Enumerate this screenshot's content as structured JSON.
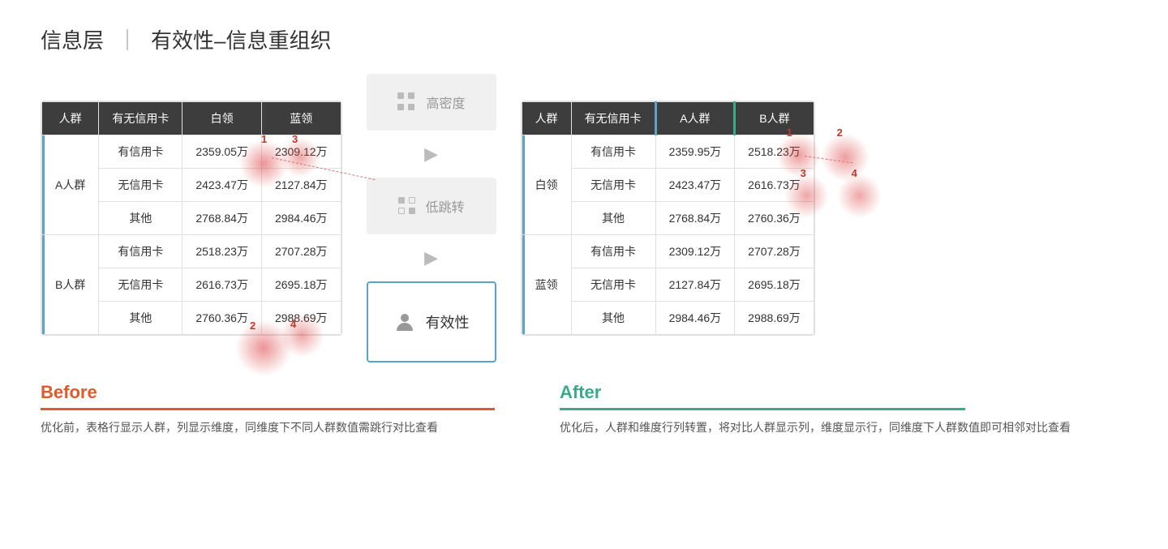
{
  "title": {
    "main": "信息层",
    "divider": "｜",
    "sub": "有效性–信息重组织"
  },
  "before_table": {
    "headers": [
      "人群",
      "有无信用卡",
      "白领",
      "蓝领"
    ],
    "rows": [
      {
        "group": "A人群",
        "group_label": "A人群",
        "sub_rows": [
          {
            "dim": "有信用卡",
            "col1": "2359.05万",
            "col2": "2309.12万"
          },
          {
            "dim": "无信用卡",
            "col1": "2423.47万",
            "col2": "2127.84万"
          },
          {
            "dim": "其他",
            "col1": "2768.84万",
            "col2": "2984.46万"
          }
        ]
      },
      {
        "group": "B人群",
        "group_label": "B人群",
        "sub_rows": [
          {
            "dim": "有信用卡",
            "col1": "2518.23万",
            "col2": "2707.28万"
          },
          {
            "dim": "无信用卡",
            "col1": "2616.73万",
            "col2": "2695.18万"
          },
          {
            "dim": "其他",
            "col1": "2760.36万",
            "col2": "2988.69万"
          }
        ]
      }
    ]
  },
  "middle": {
    "high_density": "高密度",
    "low_jump": "低跳转",
    "effectiveness": "有效性",
    "arrow": "▶"
  },
  "after_table": {
    "headers": [
      "人群",
      "有无信用卡",
      "A人群",
      "B人群"
    ],
    "rows": [
      {
        "group": "白领",
        "group_label": "白领",
        "sub_rows": [
          {
            "dim": "有信用卡",
            "col1": "2359.95万",
            "col2": "2518.23万"
          },
          {
            "dim": "无信用卡",
            "col1": "2423.47万",
            "col2": "2616.73万"
          },
          {
            "dim": "其他",
            "col1": "2768.84万",
            "col2": "2760.36万"
          }
        ]
      },
      {
        "group": "蓝领",
        "group_label": "蓝领",
        "sub_rows": [
          {
            "dim": "有信用卡",
            "col1": "2309.12万",
            "col2": "2707.28万"
          },
          {
            "dim": "无信用卡",
            "col1": "2127.84万",
            "col2": "2695.18万"
          },
          {
            "dim": "其他",
            "col1": "2984.46万",
            "col2": "2988.69万"
          }
        ]
      }
    ]
  },
  "before": {
    "label": "Before",
    "text": "优化前，表格行显示人群，列显示维度，同维度下不同人群数值需跳行对比查看"
  },
  "after": {
    "label": "After",
    "text": "优化后，人群和维度行列转置，将对比人群显示列，维度显示行，同维度下人群数值即可相邻对比查看"
  },
  "labels": [
    "1",
    "2",
    "3",
    "4"
  ],
  "colors": {
    "accent_blue": "#5ba4c8",
    "accent_green": "#3aaa8a",
    "before_color": "#e05a2b",
    "header_dark": "#3d3d3d"
  }
}
